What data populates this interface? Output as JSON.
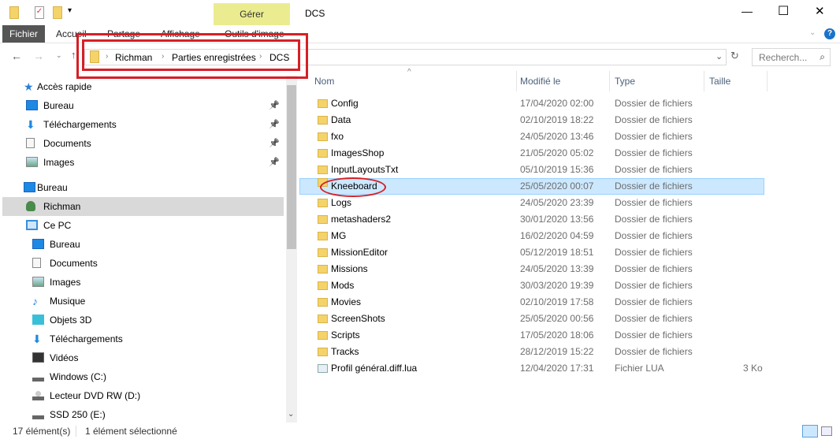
{
  "window": {
    "title": "DCS",
    "minimize": "—",
    "maximize": "☐",
    "close": "✕",
    "help": "?"
  },
  "ribbon": {
    "file_tab": "Fichier",
    "tabs": [
      "Accueil",
      "Partage",
      "Affichage",
      "Outils d'image"
    ],
    "context_group": "Gérer"
  },
  "address": {
    "crumbs": [
      "Richman",
      "Parties enregistrées",
      "DCS"
    ],
    "search_placeholder": "Recherch..."
  },
  "columns": [
    "Nom",
    "Modifié le",
    "Type",
    "Taille"
  ],
  "sidebar": [
    {
      "label": "Accès rapide",
      "icon": "star-icon",
      "indent": 0
    },
    {
      "label": "Bureau",
      "icon": "desktop-icon",
      "indent": 1,
      "pinned": true
    },
    {
      "label": "Téléchargements",
      "icon": "download-icon",
      "indent": 1,
      "pinned": true
    },
    {
      "label": "Documents",
      "icon": "document-icon",
      "indent": 1,
      "pinned": true
    },
    {
      "label": "Images",
      "icon": "image-icon",
      "indent": 1,
      "pinned": true
    },
    {
      "label": "Bureau",
      "icon": "desktop-icon",
      "indent": 0,
      "gap": true
    },
    {
      "label": "Richman",
      "icon": "user-icon",
      "indent": 1,
      "selected": true
    },
    {
      "label": "Ce PC",
      "icon": "computer-icon",
      "indent": 1
    },
    {
      "label": "Bureau",
      "icon": "desktop-icon",
      "indent": 2
    },
    {
      "label": "Documents",
      "icon": "document-icon",
      "indent": 2
    },
    {
      "label": "Images",
      "icon": "image-icon",
      "indent": 2
    },
    {
      "label": "Musique",
      "icon": "music-icon",
      "indent": 2
    },
    {
      "label": "Objets 3D",
      "icon": "cube-icon",
      "indent": 2
    },
    {
      "label": "Téléchargements",
      "icon": "download-icon",
      "indent": 2
    },
    {
      "label": "Vidéos",
      "icon": "video-icon",
      "indent": 2
    },
    {
      "label": "Windows (C:)",
      "icon": "drive-icon",
      "indent": 2
    },
    {
      "label": "Lecteur DVD RW (D:)",
      "icon": "dvd-drive-icon",
      "indent": 2
    },
    {
      "label": "SSD 250 (E:)",
      "icon": "drive-icon",
      "indent": 2
    }
  ],
  "files": [
    {
      "name": "Config",
      "date": "17/04/2020 02:00",
      "type": "Dossier de fichiers",
      "size": ""
    },
    {
      "name": "Data",
      "date": "02/10/2019 18:22",
      "type": "Dossier de fichiers",
      "size": ""
    },
    {
      "name": "fxo",
      "date": "24/05/2020 13:46",
      "type": "Dossier de fichiers",
      "size": ""
    },
    {
      "name": "ImagesShop",
      "date": "21/05/2020 05:02",
      "type": "Dossier de fichiers",
      "size": ""
    },
    {
      "name": "InputLayoutsTxt",
      "date": "05/10/2019 15:36",
      "type": "Dossier de fichiers",
      "size": ""
    },
    {
      "name": "Kneeboard",
      "date": "25/05/2020 00:07",
      "type": "Dossier de fichiers",
      "size": "",
      "selected": true
    },
    {
      "name": "Logs",
      "date": "24/05/2020 23:39",
      "type": "Dossier de fichiers",
      "size": ""
    },
    {
      "name": "metashaders2",
      "date": "30/01/2020 13:56",
      "type": "Dossier de fichiers",
      "size": ""
    },
    {
      "name": "MG",
      "date": "16/02/2020 04:59",
      "type": "Dossier de fichiers",
      "size": ""
    },
    {
      "name": "MissionEditor",
      "date": "05/12/2019 18:51",
      "type": "Dossier de fichiers",
      "size": ""
    },
    {
      "name": "Missions",
      "date": "24/05/2020 13:39",
      "type": "Dossier de fichiers",
      "size": ""
    },
    {
      "name": "Mods",
      "date": "30/03/2020 19:39",
      "type": "Dossier de fichiers",
      "size": ""
    },
    {
      "name": "Movies",
      "date": "02/10/2019 17:58",
      "type": "Dossier de fichiers",
      "size": ""
    },
    {
      "name": "ScreenShots",
      "date": "25/05/2020 00:56",
      "type": "Dossier de fichiers",
      "size": ""
    },
    {
      "name": "Scripts",
      "date": "17/05/2020 18:06",
      "type": "Dossier de fichiers",
      "size": ""
    },
    {
      "name": "Tracks",
      "date": "28/12/2019 15:22",
      "type": "Dossier de fichiers",
      "size": ""
    },
    {
      "name": "Profil général.diff.lua",
      "date": "12/04/2020 17:31",
      "type": "Fichier LUA",
      "size": "3 Ko",
      "lua": true
    }
  ],
  "status": {
    "count": "17 élément(s)",
    "selection": "1 élément sélectionné"
  },
  "colors": {
    "annotation": "#d71f26",
    "selection": "#cce8ff",
    "context_tab": "#ebec8f"
  }
}
